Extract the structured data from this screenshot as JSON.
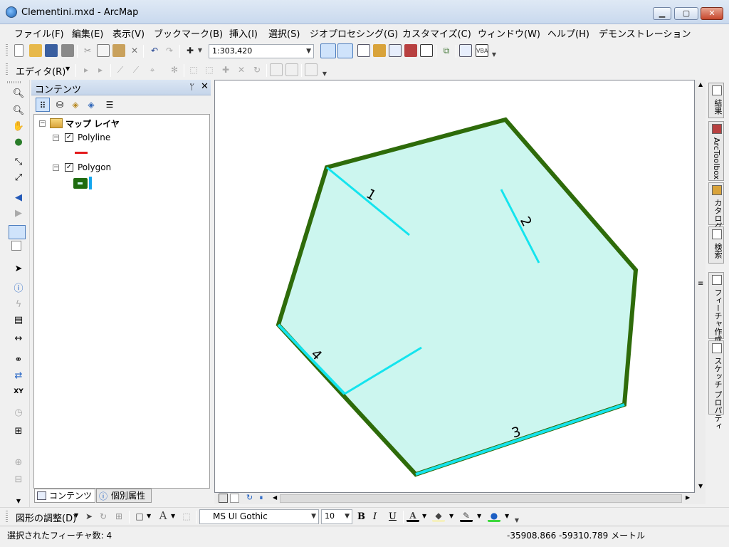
{
  "window": {
    "title": "Clementini.mxd - ArcMap",
    "minimize": "▁",
    "maximize": "▢",
    "close": "✕"
  },
  "menu": [
    "ファイル(F)",
    "編集(E)",
    "表示(V)",
    "ブックマーク(B)",
    "挿入(I)",
    "選択(S)",
    "ジオプロセシング(G)",
    "カスタマイズ(C)",
    "ウィンドウ(W)",
    "ヘルプ(H)",
    "デモンストレーション"
  ],
  "standard_toolbar": {
    "scale": "1:303,420"
  },
  "editor_toolbar": {
    "label": "エディタ(R)"
  },
  "toc": {
    "title": "コンテンツ",
    "pin": "ᛘ",
    "close": "✕",
    "root": "マップ レイヤ",
    "layers": [
      {
        "name": "Polyline",
        "checked": true,
        "symbol_color": "#e31a1c"
      },
      {
        "name": "Polygon",
        "checked": true,
        "symbol_color": "#1e6b0f"
      }
    ],
    "tabs": [
      "コンテンツ",
      "個別属性"
    ]
  },
  "map": {
    "polygon_fill": "#ccf6ef",
    "polygon_outline": "#2e6b0a",
    "highlight_color": "#14e4ee",
    "line_labels": [
      "1",
      "2",
      "3",
      "4"
    ]
  },
  "right_dock": [
    "結果",
    "ArcToolbox",
    "カタログ",
    "検索",
    "フィーチャ作成",
    "スケッチ プロパティ"
  ],
  "drawing_toolbar": {
    "label": "図形の調整(D)",
    "font": "MS UI Gothic",
    "size": "10",
    "bold": "B",
    "italic": "I",
    "underline": "U"
  },
  "status": {
    "selection": "選択されたフィーチャ数: 4",
    "coordinates": "-35908.866  -59310.789 メートル"
  }
}
